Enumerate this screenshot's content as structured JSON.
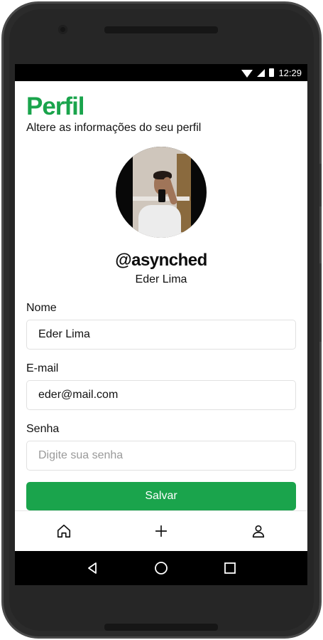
{
  "status_bar": {
    "time": "12:29",
    "icons": [
      "wifi-icon",
      "signal-icon",
      "battery-icon"
    ]
  },
  "header": {
    "title": "Perfil",
    "subtitle": "Altere as informações do seu perfil"
  },
  "profile": {
    "username": "@asynched",
    "name": "Eder Lima"
  },
  "form": {
    "name_label": "Nome",
    "name_value": "Eder Lima",
    "email_label": "E-mail",
    "email_value": "eder@mail.com",
    "password_label": "Senha",
    "password_value": "",
    "password_placeholder": "Digite sua senha",
    "save_label": "Salvar"
  },
  "bottom_nav": {
    "items": [
      {
        "icon": "home-icon"
      },
      {
        "icon": "plus-icon"
      },
      {
        "icon": "user-icon"
      }
    ]
  },
  "android_nav": {
    "items": [
      {
        "icon": "back-icon"
      },
      {
        "icon": "home-circle-icon"
      },
      {
        "icon": "recents-icon"
      }
    ]
  },
  "colors": {
    "accent": "#1aa44c",
    "background": "#ffffff",
    "device_frame": "#2b2b2b"
  }
}
